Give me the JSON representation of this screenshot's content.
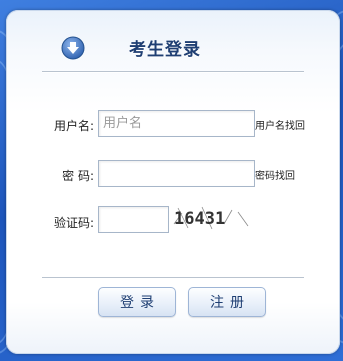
{
  "header": {
    "title": "考生登录",
    "icon": "down-arrow-circle-icon",
    "accent_color": "#1f3f73"
  },
  "form": {
    "username": {
      "label": "用户名:",
      "placeholder": "用户名",
      "value": "",
      "recover_link": "用户名找回"
    },
    "password": {
      "label": "密 码:",
      "value": "",
      "recover_link": "密码找回"
    },
    "captcha": {
      "label": "验证码:",
      "value": "",
      "image_text": "16431"
    }
  },
  "buttons": {
    "login": "登录",
    "register": "注册"
  }
}
